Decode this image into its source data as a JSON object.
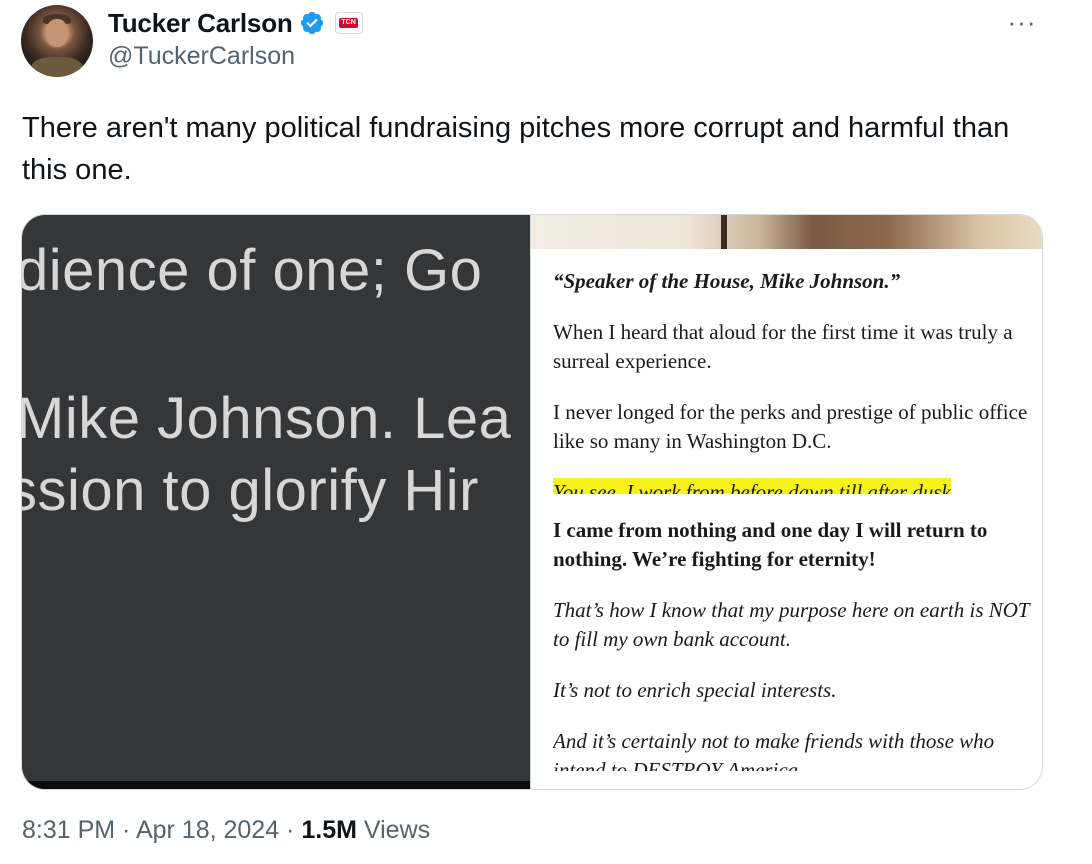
{
  "author": {
    "display_name": "Tucker Carlson",
    "handle": "@TuckerCarlson",
    "affiliate_badge": "TCN",
    "verified_icon": "verified-badge-icon",
    "verified_color": "#1d9bf0"
  },
  "more_label": "···",
  "tweet_text": "There aren't many political fundraising pitches more corrupt and harmful than this one.",
  "media": {
    "left_lines": [
      "dience of one; Go",
      "Mike Johnson. Lea",
      "ssion to glorify Hir"
    ],
    "right": {
      "quote": "“Speaker of the House, Mike Johnson.”",
      "p1": "When I heard that aloud for the first time it was truly a surreal experience.",
      "p2": "I never longed for the perks and prestige of public office like so many in Washington D.C.",
      "highlight": "You see, I work from before dawn till after dusk",
      "p3": "I came from nothing and one day I will return to nothing. We’re fighting for eternity!",
      "p4": "That’s how I know that my purpose here on earth is NOT to fill my own bank account.",
      "p5": "It’s not to enrich special interests.",
      "p6": "And it’s certainly not to make friends with those who intend to DESTROY America."
    }
  },
  "meta": {
    "time": "8:31 PM",
    "sep1": " · ",
    "date": "Apr 18, 2024",
    "sep2": " · ",
    "views_count": "1.5M",
    "views_label": " Views"
  }
}
